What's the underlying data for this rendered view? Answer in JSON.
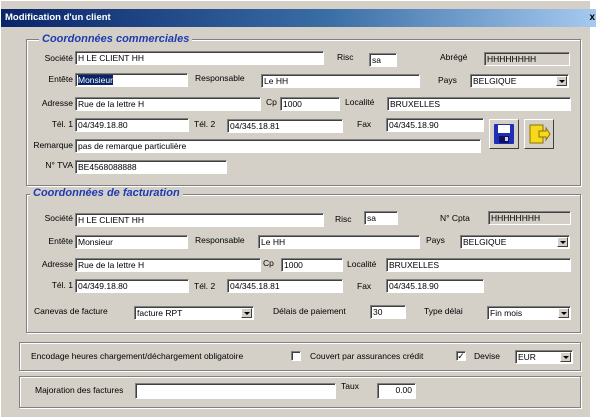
{
  "window": {
    "title": "Modification d'un client",
    "close": "x"
  },
  "commercial": {
    "legend": "Coordonnées commerciales",
    "societe_label": "Société",
    "societe": "H LE CLIENT HH",
    "risc_label": "Risc",
    "risc": "sa",
    "abrege_label": "Abrégé",
    "abrege": "HHHHHHHH",
    "entete_label": "Entête",
    "entete": "Monsieur",
    "responsable_label": "Responsable",
    "responsable": "Le HH",
    "pays_label": "Pays",
    "pays": "BELGIQUE",
    "adresse_label": "Adresse",
    "adresse": "Rue de la lettre H",
    "cp_label": "Cp",
    "cp": "1000",
    "localite_label": "Localité",
    "localite": "BRUXELLES",
    "tel1_label": "Tél. 1",
    "tel1": "04/349.18.80",
    "tel2_label": "Tél. 2",
    "tel2": "04/345.18.81",
    "fax_label": "Fax",
    "fax": "04/345.18.90",
    "remarque_label": "Remarque",
    "remarque": "pas de remarque particulière",
    "tva_label": "N° TVA",
    "tva": "BE4568088888"
  },
  "facturation": {
    "legend": "Coordonnées de facturation",
    "societe_label": "Société",
    "societe": "H LE CLIENT HH",
    "risc_label": "Risc",
    "risc": "sa",
    "ncpta_label": "N° Cpta",
    "ncpta": "HHHHHHHH",
    "entete_label": "Entête",
    "entete": "Monsieur",
    "responsable_label": "Responsable",
    "responsable": "Le HH",
    "pays_label": "Pays",
    "pays": "BELGIQUE",
    "adresse_label": "Adresse",
    "adresse": "Rue de la lettre H",
    "cp_label": "Cp",
    "cp": "1000",
    "localite_label": "Localité",
    "localite": "BRUXELLES",
    "tel1_label": "Tél. 1",
    "tel1": "04/349.18.80",
    "tel2_label": "Tél. 2",
    "tel2": "04/345.18.81",
    "fax_label": "Fax",
    "fax": "04/345.18.90",
    "canevas_label": "Canevas de facture",
    "canevas": "facture RPT",
    "delais_label": "Délais de paiement",
    "delais": "30",
    "typedelai_label": "Type délai",
    "typedelai": "Fin mois"
  },
  "options": {
    "encodage_label": "Encodage heures chargement/déchargement obligatoire",
    "encodage_checked": false,
    "assurance_label": "Couvert par assurances crédit",
    "assurance_checked": true,
    "devise_label": "Devise",
    "devise": "EUR"
  },
  "majoration": {
    "label": "Majoration des factures",
    "value": "",
    "taux_label": "Taux",
    "taux": "0.00"
  }
}
